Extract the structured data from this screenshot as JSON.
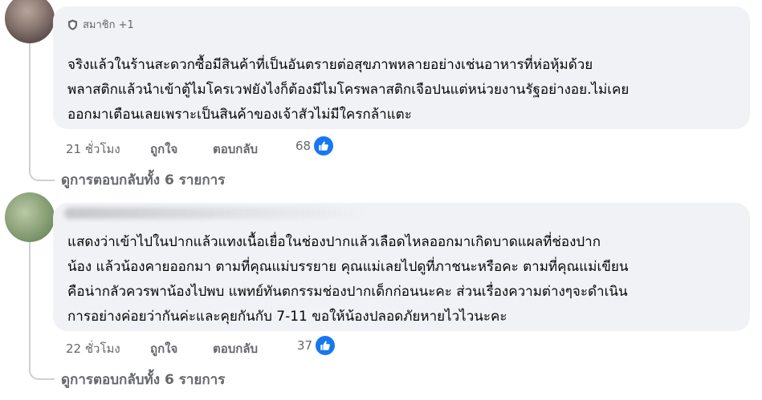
{
  "comments": [
    {
      "badge": "สมาชิก +1",
      "text_lines": [
        "จริงแล้วในร้านสะดวกซื้อมีสินค้าที่เป็นอันตรายต่อสุขภาพหลายอย่างเช่นอาหารที่ห่อหุ้มด้วย",
        "พลาสติกแล้วนำเข้าตู้ไมโครเวฟยังไงก็ต้องมีไมโครพลาสติกเจือปนแต่หน่วยงานรัฐอย่างอย.ไม่เคย",
        "ออกมาเตือนเลยเพราะเป็นสินค้าของเจ้าสัวไม่มีใครกล้าแตะ"
      ],
      "time": "21 ชั่วโมง",
      "like_label": "ถูกใจ",
      "reply_label": "ตอบกลับ",
      "reaction_count": "68",
      "view_replies": "ดูการตอบกลับทั้ง 6 รายการ"
    },
    {
      "text_lines": [
        "แสดงว่าเข้าไปในปากแล้วแทงเนื้อเยื่อในช่องปากแล้วเลือดไหลออกมาเกิดบาดแผลที่ช่องปาก",
        "น้อง แล้วน้องคายออกมา ตามที่คุณแม่บรรยาย คุณแม่เลยไปดูที่ภาชนะหรือคะ ตามที่คุณแม่เขียน",
        "คือน่ากลัวควรพาน้องไปพบ แพทย์ทันตกรรมช่องปากเด็กก่อนนะคะ ส่วนเรื่องความต่างๆจะดำเนิน",
        "การอย่างค่อยว่ากันค่ะและคุยกันกับ 7-11 ขอให้น้องปลอดภัยหายไวไวนะคะ"
      ],
      "time": "22 ชั่วโมง",
      "like_label": "ถูกใจ",
      "reply_label": "ตอบกลับ",
      "reaction_count": "37",
      "view_replies": "ดูการตอบกลับทั้ง 6 รายการ"
    }
  ],
  "icons": {
    "badge": "shield-icon",
    "reaction": "like-reaction-icon"
  },
  "colors": {
    "bubble": "#f0f2f5",
    "secondary_text": "#65676b",
    "like_blue": "#1877f2",
    "thread_line": "#ced0d4"
  }
}
